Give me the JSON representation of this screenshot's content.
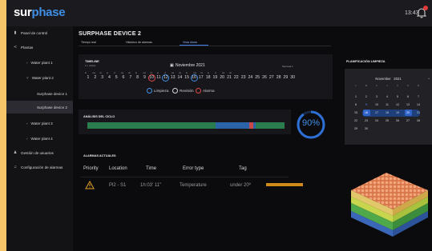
{
  "app": {
    "logo_part1": "sur",
    "logo_part2": "phase",
    "time": "13:43"
  },
  "sidebar": {
    "items": [
      {
        "label": "Panel de control",
        "icon": "chart-icon"
      },
      {
        "label": "Plantas",
        "icon": "share-icon"
      },
      {
        "label": "Water plant 1",
        "icon": "chevron-right-icon"
      },
      {
        "label": "Water plant 2",
        "icon": "chevron-down-icon"
      },
      {
        "label": "Surphase device 1"
      },
      {
        "label": "Surphase device 2"
      },
      {
        "label": "Water plant 3",
        "icon": "chevron-right-icon"
      },
      {
        "label": "Water plant 4",
        "icon": "chevron-right-icon"
      },
      {
        "label": "Gestión de usuarios",
        "icon": "users-icon"
      },
      {
        "label": "Configuración de alarmas",
        "icon": "bell-icon"
      }
    ]
  },
  "main": {
    "title": "SURPHASE DEVICE 2",
    "tabs": [
      {
        "label": "Tiempo real"
      },
      {
        "label": "Histórico de alarmas"
      },
      {
        "label": "Vista diaria"
      }
    ]
  },
  "timeline": {
    "title": "TIMELINE",
    "subtitle": "1 n visitas",
    "month": "Noviembre 2021",
    "right_label": "Semana 1",
    "weekdays": [
      "lu",
      "ma",
      "mi",
      "ju",
      "vi",
      "sá",
      "do",
      "lu",
      "ma",
      "mi",
      "ju",
      "vi",
      "sá",
      "do",
      "lu",
      "ma",
      "mi",
      "ju",
      "vi",
      "sá",
      "do"
    ],
    "days": [
      "1",
      "2",
      "3",
      "4",
      "5",
      "6",
      "7",
      "8",
      "9",
      "10",
      "11",
      "12",
      "13",
      "14",
      "15",
      "16",
      "17",
      "18",
      "19",
      "20",
      "21",
      "22",
      "23",
      "24",
      "25",
      "26",
      "27",
      "28",
      "29",
      "30"
    ],
    "legend": [
      {
        "label": "Limpieza",
        "color": "#3f8fe6"
      },
      {
        "label": "Revisión",
        "color": "#d8d8d8"
      },
      {
        "label": "Alarma",
        "color": "#e04848"
      }
    ]
  },
  "analysis": {
    "title": "ANÁLISIS DEL CICLO",
    "percent": "90%",
    "percent_value": 0.9,
    "colors": {
      "green": "#2a7d4f",
      "blue": "#2a63a8",
      "red": "#c94848"
    }
  },
  "alarms": {
    "title": "ALARMAS ACTUALES",
    "headers": [
      "Priority",
      "Location",
      "Time",
      "Error type",
      "Tag"
    ],
    "rows": [
      {
        "location": "Pl2 - S1",
        "time": "1h:03' 11''",
        "error_type": "Temperature",
        "tag": "under 20º"
      }
    ]
  },
  "planning": {
    "title": "PLANIFICACIÓN LIMPIEZA",
    "month": "November",
    "year": "2021",
    "weekdays": [
      "L",
      "M",
      "X",
      "J",
      "V",
      "S",
      "D"
    ],
    "weeks": [
      [
        "1",
        "2",
        "3",
        "4",
        "5",
        "6",
        "7"
      ],
      [
        "8",
        "9",
        "10",
        "11",
        "12",
        "13",
        "14"
      ],
      [
        "15",
        "16",
        "17",
        "18",
        "19",
        "20",
        "21"
      ],
      [
        "22",
        "23",
        "24",
        "25",
        "26",
        "27",
        "28"
      ],
      [
        "29",
        "30",
        "",
        "",
        "",
        "",
        ""
      ]
    ]
  }
}
